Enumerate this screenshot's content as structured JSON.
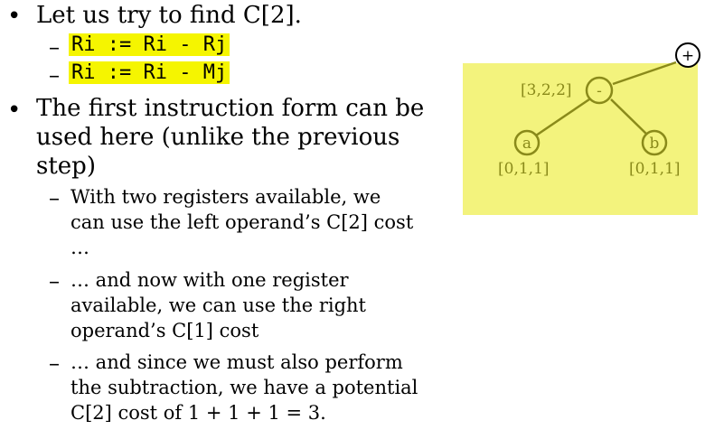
{
  "bullets": [
    {
      "text_lines": [
        "Let us try to find C[2]."
      ],
      "code_items": [
        "Ri := Ri - Rj",
        "Ri := Ri - Mj"
      ]
    },
    {
      "text_lines": [
        "The first instruction form can be",
        "used here (unlike the previous",
        "step)"
      ],
      "sub_items": [
        {
          "lines": [
            "With two registers available, we",
            "can use the left operand’s C[2] cost",
            "…"
          ]
        },
        {
          "lines": [
            "… and now with one register",
            "available, we can use the right",
            "operand’s C[1] cost"
          ]
        },
        {
          "lines": [
            "… and since we must also perform",
            "the subtraction, we have a potential",
            "C[2] cost of 1 + 1 + 1 = 3."
          ]
        }
      ]
    }
  ],
  "diagram": {
    "panel_color": "#f3f37d",
    "node_color": "#8a8a1a",
    "root_symbol": "+",
    "minus_node": {
      "symbol": "-",
      "cost": "[3,2,2]"
    },
    "leaf_a": {
      "symbol": "a",
      "cost": "[0,1,1]"
    },
    "leaf_b": {
      "symbol": "b",
      "cost": "[0,1,1]"
    }
  }
}
